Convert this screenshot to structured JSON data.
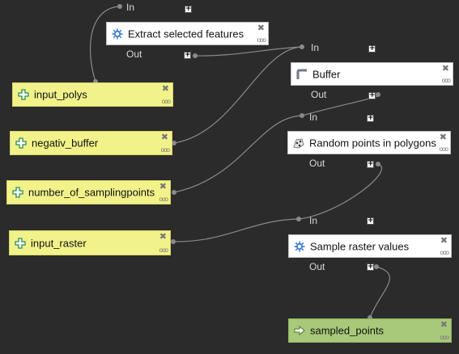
{
  "model": {
    "inputs": [
      {
        "label": "input_polys"
      },
      {
        "label": "negativ_buffer"
      },
      {
        "label": "number_of_samplingpoints"
      },
      {
        "label": "input_raster"
      }
    ],
    "algorithms": [
      {
        "label": "Extract selected features",
        "icon": "gear-icon",
        "in_label": "In",
        "out_label": "Out"
      },
      {
        "label": "Buffer",
        "icon": "buffer-icon",
        "in_label": "In",
        "out_label": "Out"
      },
      {
        "label": "Random points in polygons",
        "icon": "random-points-icon",
        "in_label": "In",
        "out_label": "Out"
      },
      {
        "label": "Sample raster values",
        "icon": "gear-icon",
        "in_label": "In",
        "out_label": "Out"
      }
    ],
    "outputs": [
      {
        "label": "sampled_points"
      }
    ],
    "close_glyph": "✖",
    "more_glyph": "ooo",
    "plus_glyph": "+"
  },
  "colors": {
    "background": "#2b2b2b",
    "input_node": "#f2f28a",
    "algorithm_node": "#ffffff",
    "output_node": "#a8c97a",
    "wire": "#8a8a8a"
  }
}
